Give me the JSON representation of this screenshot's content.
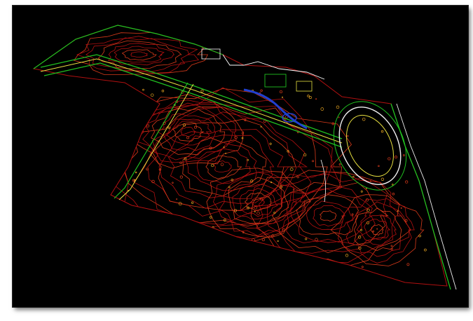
{
  "view": {
    "background": "#000000",
    "frame_border": "#2a2a2a",
    "layer_colors": {
      "contour_major": "#b01010",
      "contour_minor": "#d83a1a",
      "road_edge": "#20c020",
      "road_center": "#e8e040",
      "structures": "#ffffff",
      "water": "#2040d0",
      "features": "#e0a020",
      "track": "#f0f0f0"
    },
    "icons": [
      "cad-contour-map"
    ]
  }
}
